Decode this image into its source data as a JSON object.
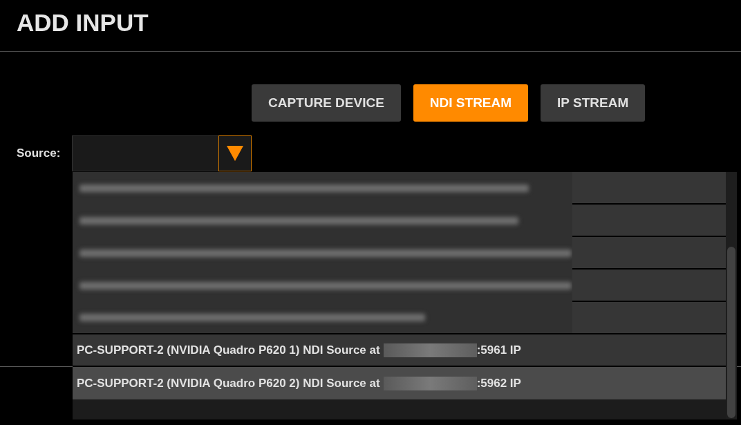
{
  "title": "ADD INPUT",
  "tabs": [
    {
      "label": "CAPTURE DEVICE",
      "selected": false
    },
    {
      "label": "NDI STREAM",
      "selected": true
    },
    {
      "label": "IP STREAM",
      "selected": false
    }
  ],
  "source": {
    "label": "Source:",
    "expanded": true,
    "options": [
      {
        "kind": "blurred",
        "selected": false
      },
      {
        "kind": "blurred",
        "selected": false
      },
      {
        "kind": "blurred",
        "selected": false
      },
      {
        "kind": "blurred",
        "selected": false
      },
      {
        "kind": "blurred",
        "selected": false
      },
      {
        "kind": "source",
        "text_before": "PC-SUPPORT-2 (NVIDIA Quadro P620 1) NDI Source at",
        "text_after": ":5961 IP",
        "selected": false
      },
      {
        "kind": "source",
        "text_before": "PC-SUPPORT-2 (NVIDIA Quadro P620 2) NDI Source at",
        "text_after": ":5962 IP",
        "selected": true
      }
    ]
  }
}
